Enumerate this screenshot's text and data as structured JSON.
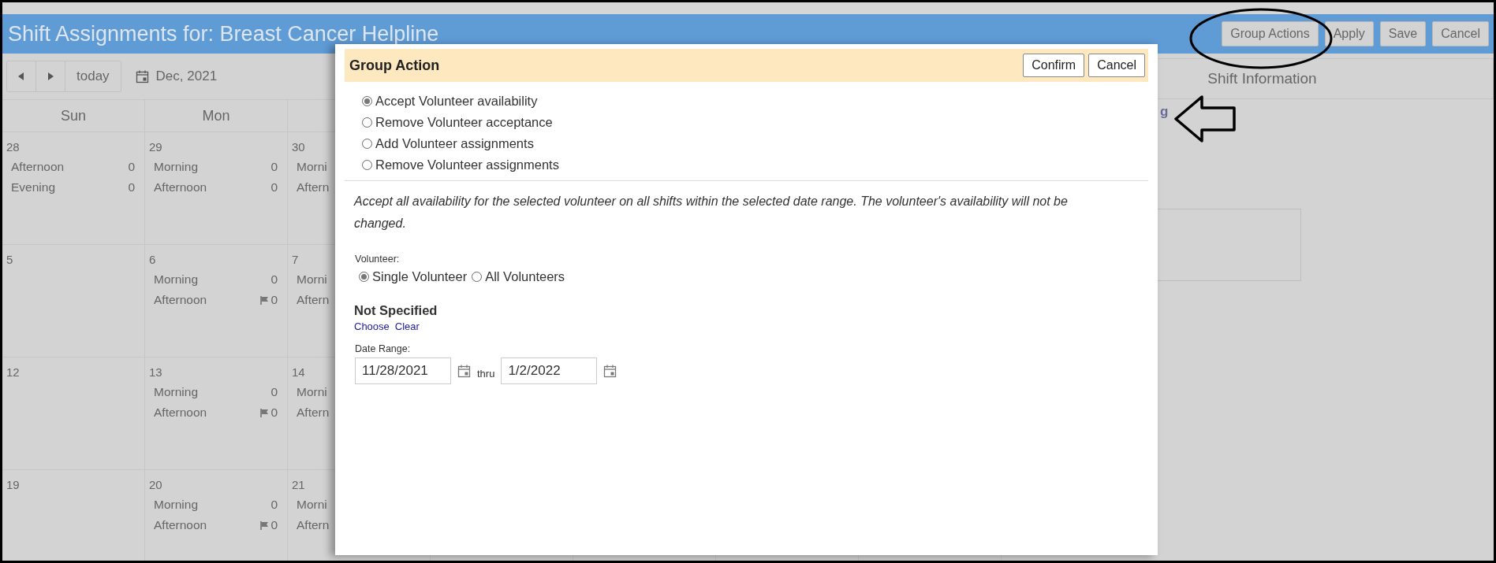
{
  "header": {
    "title": "Shift Assignments for: Breast Cancer Helpline",
    "buttons": [
      {
        "label": "Group Actions"
      },
      {
        "label": "Apply"
      },
      {
        "label": "Save"
      },
      {
        "label": "Cancel"
      }
    ]
  },
  "toolbar": {
    "today": "today",
    "month": "Dec, 2021"
  },
  "calendar": {
    "days": [
      "Sun",
      "Mon"
    ],
    "weeks": [
      {
        "cells": [
          {
            "day": "28",
            "shifts": [
              {
                "name": "Afternoon",
                "count": "0",
                "flag": false
              },
              {
                "name": "Evening",
                "count": "0",
                "flag": false
              }
            ]
          },
          {
            "day": "29",
            "shifts": [
              {
                "name": "Morning",
                "count": "0",
                "flag": false
              },
              {
                "name": "Afternoon",
                "count": "0",
                "flag": false
              }
            ]
          },
          {
            "day": "30",
            "shifts": [
              {
                "name": "Morni"
              },
              {
                "name": "Aftern"
              }
            ]
          }
        ]
      },
      {
        "cells": [
          {
            "day": "5"
          },
          {
            "day": "6",
            "shifts": [
              {
                "name": "Morning",
                "count": "0",
                "flag": false
              },
              {
                "name": "Afternoon",
                "count": "0",
                "flag": true
              }
            ]
          },
          {
            "day": "7",
            "shifts": [
              {
                "name": "Morni"
              },
              {
                "name": "Aftern"
              }
            ]
          }
        ]
      },
      {
        "cells": [
          {
            "day": "12"
          },
          {
            "day": "13",
            "shifts": [
              {
                "name": "Morning",
                "count": "0",
                "flag": false
              },
              {
                "name": "Afternoon",
                "count": "0",
                "flag": true
              }
            ]
          },
          {
            "day": "14",
            "shifts": [
              {
                "name": "Morni"
              },
              {
                "name": "Aftern"
              }
            ]
          }
        ]
      },
      {
        "cells": [
          {
            "day": "19"
          },
          {
            "day": "20",
            "shifts": [
              {
                "name": "Morning",
                "count": "0",
                "flag": false
              },
              {
                "name": "Afternoon",
                "count": "0",
                "flag": true
              }
            ]
          },
          {
            "day": "21",
            "shifts": [
              {
                "name": "Morni"
              },
              {
                "name": "Aftern"
              }
            ]
          }
        ]
      }
    ]
  },
  "shift_panel": {
    "title": "Shift Information",
    "link": "g"
  },
  "dialog": {
    "title": "Group Action",
    "buttons": [
      {
        "label": "Confirm"
      },
      {
        "label": "Cancel"
      }
    ],
    "actions": [
      {
        "label": "Accept Volunteer availability",
        "selected": true
      },
      {
        "label": "Remove Volunteer acceptance",
        "selected": false
      },
      {
        "label": "Add Volunteer assignments",
        "selected": false
      },
      {
        "label": "Remove Volunteer assignments",
        "selected": false
      }
    ],
    "description": "Accept all availability for the selected volunteer on all shifts within the selected date range. The volunteer's availability will not be changed.",
    "volunteer": {
      "label": "Volunteer:",
      "options": [
        {
          "label": "Single Volunteer",
          "selected": true
        },
        {
          "label": "All Volunteers",
          "selected": false
        }
      ]
    },
    "selection": "Not Specified",
    "links": [
      "Choose",
      "Clear"
    ],
    "date_range": {
      "label": "Date Range:",
      "from": "11/28/2021",
      "separator": "thru",
      "to": "1/2/2022"
    }
  }
}
